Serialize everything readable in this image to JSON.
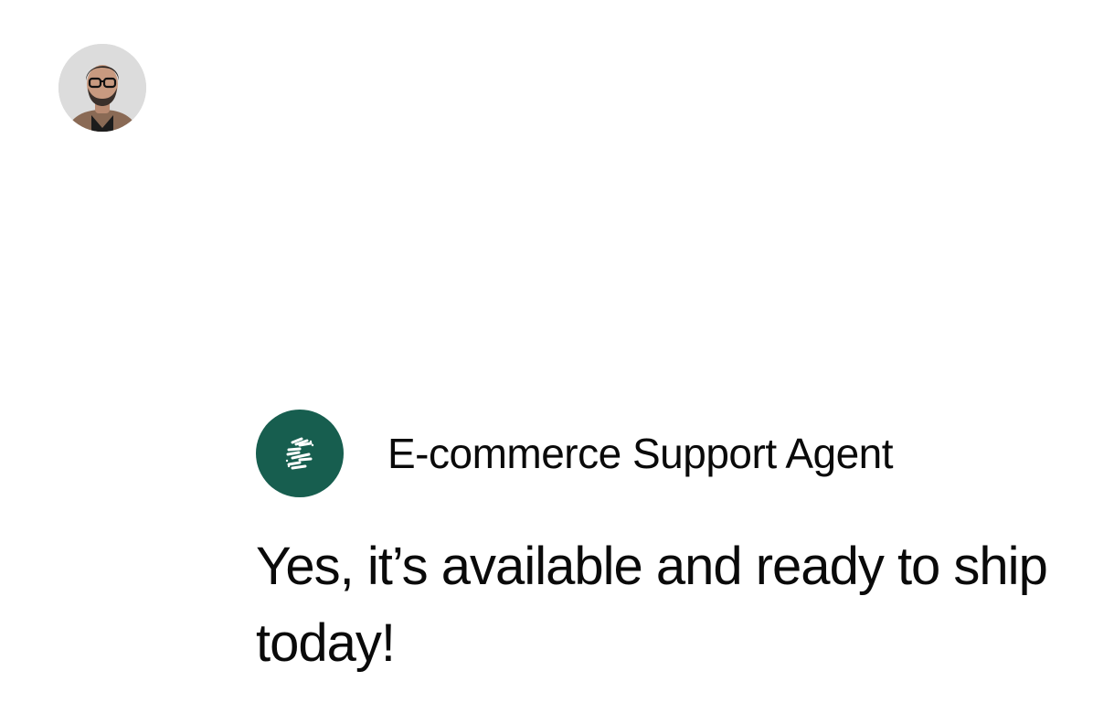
{
  "user": {
    "avatar_icon": "user-avatar-photo"
  },
  "agent": {
    "logo_icon": "stripe-s-logo-icon",
    "logo_color": "#175e4f",
    "name": "E-commerce Support Agent",
    "message": "Yes, it’s available and ready to ship today!"
  }
}
